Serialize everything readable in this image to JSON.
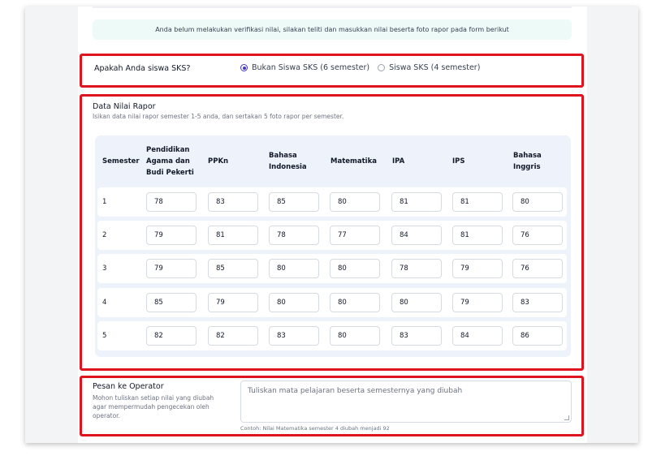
{
  "notice": "Anda belum melakukan verifikasi nilai, silakan teliti dan masukkan nilai beserta foto rapor pada form berikut",
  "sks": {
    "question": "Apakah Anda siswa SKS?",
    "options": [
      {
        "label": "Bukan Siswa SKS (6 semester)",
        "selected": true
      },
      {
        "label": "Siswa SKS (4 semester)",
        "selected": false
      }
    ]
  },
  "rapor": {
    "title": "Data Nilai Rapor",
    "subtitle": "Isikan data nilai rapor semester 1-5 anda, dan sertakan 5 foto rapor per semester.",
    "headers": [
      "Semester",
      "Pendidikan Agama dan Budi Pekerti",
      "PPKn",
      "Bahasa Indonesia",
      "Matematika",
      "IPA",
      "IPS",
      "Bahasa Inggris"
    ],
    "rows": [
      {
        "semester": "1",
        "values": [
          "78",
          "83",
          "85",
          "80",
          "81",
          "81",
          "80"
        ]
      },
      {
        "semester": "2",
        "values": [
          "79",
          "81",
          "78",
          "77",
          "84",
          "81",
          "76"
        ]
      },
      {
        "semester": "3",
        "values": [
          "79",
          "85",
          "80",
          "80",
          "78",
          "79",
          "76"
        ]
      },
      {
        "semester": "4",
        "values": [
          "85",
          "79",
          "80",
          "80",
          "80",
          "79",
          "83"
        ]
      },
      {
        "semester": "5",
        "values": [
          "82",
          "82",
          "83",
          "80",
          "83",
          "84",
          "86"
        ]
      }
    ]
  },
  "pesan": {
    "title": "Pesan ke Operator",
    "description": "Mohon tuliskan setiap nilai yang diubah agar mempermudah pengecekan oleh operator.",
    "placeholder": "Tuliskan mata pelajaran beserta semesternya yang diubah",
    "hint": "Contoh: Nilai Matematika semester 4 diubah menjadi 92"
  },
  "colors": {
    "highlight": "#e0141e",
    "accent": "#4338ca",
    "notice_bg": "#eefaf8",
    "table_bg": "#eef2fb"
  }
}
